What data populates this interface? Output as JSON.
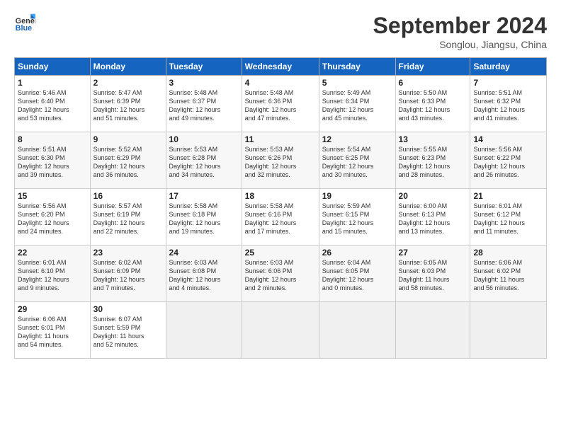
{
  "header": {
    "logo_line1": "General",
    "logo_line2": "Blue",
    "month": "September 2024",
    "location": "Songlou, Jiangsu, China"
  },
  "weekdays": [
    "Sunday",
    "Monday",
    "Tuesday",
    "Wednesday",
    "Thursday",
    "Friday",
    "Saturday"
  ],
  "weeks": [
    [
      {
        "day": "1",
        "info": "Sunrise: 5:46 AM\nSunset: 6:40 PM\nDaylight: 12 hours\nand 53 minutes."
      },
      {
        "day": "2",
        "info": "Sunrise: 5:47 AM\nSunset: 6:39 PM\nDaylight: 12 hours\nand 51 minutes."
      },
      {
        "day": "3",
        "info": "Sunrise: 5:48 AM\nSunset: 6:37 PM\nDaylight: 12 hours\nand 49 minutes."
      },
      {
        "day": "4",
        "info": "Sunrise: 5:48 AM\nSunset: 6:36 PM\nDaylight: 12 hours\nand 47 minutes."
      },
      {
        "day": "5",
        "info": "Sunrise: 5:49 AM\nSunset: 6:34 PM\nDaylight: 12 hours\nand 45 minutes."
      },
      {
        "day": "6",
        "info": "Sunrise: 5:50 AM\nSunset: 6:33 PM\nDaylight: 12 hours\nand 43 minutes."
      },
      {
        "day": "7",
        "info": "Sunrise: 5:51 AM\nSunset: 6:32 PM\nDaylight: 12 hours\nand 41 minutes."
      }
    ],
    [
      {
        "day": "8",
        "info": "Sunrise: 5:51 AM\nSunset: 6:30 PM\nDaylight: 12 hours\nand 39 minutes."
      },
      {
        "day": "9",
        "info": "Sunrise: 5:52 AM\nSunset: 6:29 PM\nDaylight: 12 hours\nand 36 minutes."
      },
      {
        "day": "10",
        "info": "Sunrise: 5:53 AM\nSunset: 6:28 PM\nDaylight: 12 hours\nand 34 minutes."
      },
      {
        "day": "11",
        "info": "Sunrise: 5:53 AM\nSunset: 6:26 PM\nDaylight: 12 hours\nand 32 minutes."
      },
      {
        "day": "12",
        "info": "Sunrise: 5:54 AM\nSunset: 6:25 PM\nDaylight: 12 hours\nand 30 minutes."
      },
      {
        "day": "13",
        "info": "Sunrise: 5:55 AM\nSunset: 6:23 PM\nDaylight: 12 hours\nand 28 minutes."
      },
      {
        "day": "14",
        "info": "Sunrise: 5:56 AM\nSunset: 6:22 PM\nDaylight: 12 hours\nand 26 minutes."
      }
    ],
    [
      {
        "day": "15",
        "info": "Sunrise: 5:56 AM\nSunset: 6:20 PM\nDaylight: 12 hours\nand 24 minutes."
      },
      {
        "day": "16",
        "info": "Sunrise: 5:57 AM\nSunset: 6:19 PM\nDaylight: 12 hours\nand 22 minutes."
      },
      {
        "day": "17",
        "info": "Sunrise: 5:58 AM\nSunset: 6:18 PM\nDaylight: 12 hours\nand 19 minutes."
      },
      {
        "day": "18",
        "info": "Sunrise: 5:58 AM\nSunset: 6:16 PM\nDaylight: 12 hours\nand 17 minutes."
      },
      {
        "day": "19",
        "info": "Sunrise: 5:59 AM\nSunset: 6:15 PM\nDaylight: 12 hours\nand 15 minutes."
      },
      {
        "day": "20",
        "info": "Sunrise: 6:00 AM\nSunset: 6:13 PM\nDaylight: 12 hours\nand 13 minutes."
      },
      {
        "day": "21",
        "info": "Sunrise: 6:01 AM\nSunset: 6:12 PM\nDaylight: 12 hours\nand 11 minutes."
      }
    ],
    [
      {
        "day": "22",
        "info": "Sunrise: 6:01 AM\nSunset: 6:10 PM\nDaylight: 12 hours\nand 9 minutes."
      },
      {
        "day": "23",
        "info": "Sunrise: 6:02 AM\nSunset: 6:09 PM\nDaylight: 12 hours\nand 7 minutes."
      },
      {
        "day": "24",
        "info": "Sunrise: 6:03 AM\nSunset: 6:08 PM\nDaylight: 12 hours\nand 4 minutes."
      },
      {
        "day": "25",
        "info": "Sunrise: 6:03 AM\nSunset: 6:06 PM\nDaylight: 12 hours\nand 2 minutes."
      },
      {
        "day": "26",
        "info": "Sunrise: 6:04 AM\nSunset: 6:05 PM\nDaylight: 12 hours\nand 0 minutes."
      },
      {
        "day": "27",
        "info": "Sunrise: 6:05 AM\nSunset: 6:03 PM\nDaylight: 11 hours\nand 58 minutes."
      },
      {
        "day": "28",
        "info": "Sunrise: 6:06 AM\nSunset: 6:02 PM\nDaylight: 11 hours\nand 56 minutes."
      }
    ],
    [
      {
        "day": "29",
        "info": "Sunrise: 6:06 AM\nSunset: 6:01 PM\nDaylight: 11 hours\nand 54 minutes."
      },
      {
        "day": "30",
        "info": "Sunrise: 6:07 AM\nSunset: 5:59 PM\nDaylight: 11 hours\nand 52 minutes."
      },
      {
        "day": "",
        "info": ""
      },
      {
        "day": "",
        "info": ""
      },
      {
        "day": "",
        "info": ""
      },
      {
        "day": "",
        "info": ""
      },
      {
        "day": "",
        "info": ""
      }
    ]
  ]
}
